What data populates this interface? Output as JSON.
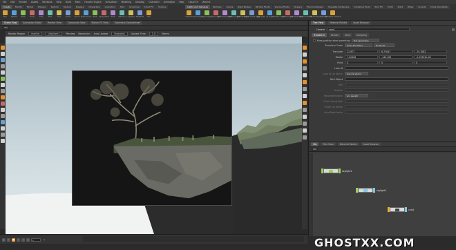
{
  "menubar": {
    "items": [
      "File",
      "Edit",
      "Render",
      "Assets",
      "Windows",
      "Help",
      "Build",
      "Main",
      "Houdini Engine",
      "Simulation",
      "Modeling",
      "Desktop",
      "Character",
      "Animation",
      "Help",
      "Cloud FX",
      "Volume"
    ]
  },
  "shelf": {
    "left_tabs": [
      "Create",
      "Modify",
      "Model",
      "Polygon",
      "Deform",
      "Texture",
      "Rigging",
      "Characters",
      "Animation",
      "Hair",
      "Grooming",
      "Cloud FX",
      "Volume"
    ],
    "left_tools": [
      "Box",
      "Sphere",
      "Tube",
      "Torus",
      "Grid",
      "Null",
      "Line",
      "Circle",
      "Curve",
      "Draw Curve",
      "Path",
      "Spray Paint",
      "Font",
      "Platonic",
      "L-System",
      "Metaball",
      "File"
    ],
    "right_tabs": [
      "Lights and Cameras",
      "Particles",
      "Grains",
      "Rigid Bodies",
      "Particle Fluids",
      "Viscous Fluids",
      "Oceans",
      "Fluid Containers",
      "Populate Containers",
      "Container Tools",
      "Pyro FX",
      "Cloth",
      "Solid",
      "Wires",
      "Crowds",
      "Drive Simulation"
    ],
    "right_tools": [
      "Camera",
      "Point Light",
      "Spot Light",
      "Area Light",
      "Geometry Light",
      "Volume Light",
      "Distant Light",
      "Environment Light",
      "Sky Light",
      "GI Light",
      "Caustic Light",
      "Portal Light",
      "Ambient Light",
      "Stereo Camera",
      "VR Camera",
      "Switcher",
      "Gamepad Camera"
    ]
  },
  "viewport": {
    "tabs": [
      "Scene View",
      "Animation Editor",
      "Render View",
      "Composite View",
      "Motion FX View",
      "Geometry Spreadsheet"
    ],
    "toolbar": {
      "renderer_label": "Render Region",
      "renderer_value": "mantra",
      "camera_value": "/obj/cam1",
      "preview_label": "Preview",
      "ratio_label": "Resolution",
      "auto_update_label": "Auto Update",
      "snapshot_label": "Snapshot",
      "update_time_label": "Update Time",
      "update_time_value": "1.0",
      "stereo_label": "Stereo"
    }
  },
  "parameters": {
    "tabs": [
      "Tree View",
      "Material Palette",
      "Asset Browser"
    ],
    "node_type": "Camera",
    "node_name": "cam1",
    "subtabs": [
      "Transform",
      "Render",
      "View",
      "Sampling"
    ],
    "keep_position_label": "Keep position when parenting",
    "keep_position_value": "Not applicable",
    "transform_order_label": "Transform Order",
    "transform_order_value": "Scale Rot Trans",
    "rotate_order_value": "Rx Ry Rz",
    "rows": [
      {
        "label": "Translate",
        "values": [
          "11.977",
          "6.73047",
          "-74.1082"
        ]
      },
      {
        "label": "Rotate",
        "values": [
          "7.22628",
          "-149.409",
          "-1.25353e-06"
        ]
      },
      {
        "label": "Pivot",
        "values": [
          "0",
          "0",
          "0"
        ]
      },
      {
        "label": "Look At",
        "values": [
          ""
        ]
      },
      {
        "label": "Look At Up Vector",
        "values": [
          "Use Up Vector"
        ]
      },
      {
        "label": "Path Object",
        "values": [
          ""
        ]
      },
      {
        "label": "Roll",
        "values": [
          ""
        ]
      },
      {
        "label": "Position",
        "values": [
          ""
        ]
      },
      {
        "label": "Parameterization",
        "values": [
          "Arc Length"
        ]
      },
      {
        "label": "Orient Along Path",
        "values": [
          ""
        ]
      },
      {
        "label": "Orient Up Vector",
        "values": [
          ""
        ]
      },
      {
        "label": "Auto-Bank factor",
        "values": [
          ""
        ]
      }
    ]
  },
  "network": {
    "tabs": [
      "Obj",
      "Tree View",
      "Material Palette",
      "Asset Browser"
    ],
    "path": "obj",
    "nodes": [
      {
        "name": "skylight1",
        "color": "#9bd15a"
      },
      {
        "name": "skylight1",
        "color": "#7fc8e0"
      },
      {
        "name": "cam1",
        "color": "#f0b040"
      }
    ]
  },
  "timeline": {
    "current_frame": "1",
    "start_frame": "1",
    "end_frame": "240"
  },
  "watermark": "GHOSTXX.COM",
  "colors": {
    "accent_orange": "#e6922e",
    "panel_bg": "#393939",
    "viewport_sky": "#c8d6db",
    "field_bg": "#262626"
  }
}
